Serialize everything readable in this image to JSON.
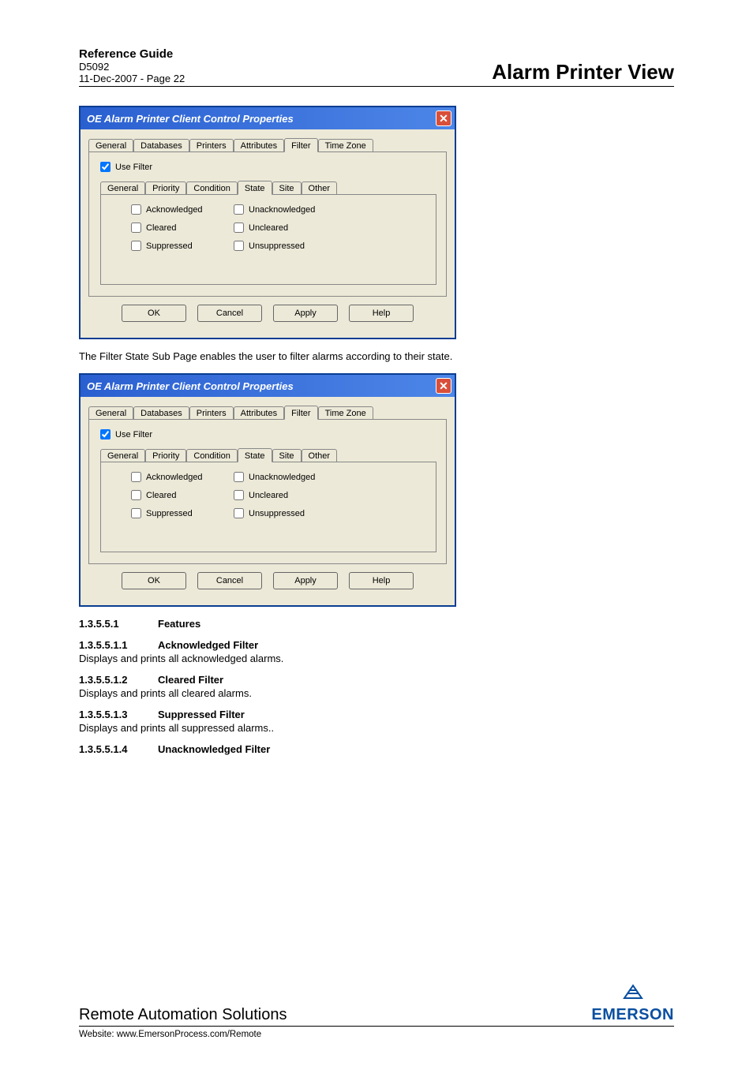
{
  "header": {
    "ref_guide": "Reference Guide",
    "doc_id": "D5092",
    "date_page": "11-Dec-2007 - Page 22",
    "view_title": "Alarm Printer View"
  },
  "dialog": {
    "title": "OE Alarm Printer Client Control Properties",
    "close_icon": "✕",
    "main_tabs": [
      "General",
      "Databases",
      "Printers",
      "Attributes",
      "Filter",
      "Time Zone"
    ],
    "main_tab_selected": 4,
    "use_filter_label": "Use Filter",
    "use_filter_checked": true,
    "sub_tabs": [
      "General",
      "Priority",
      "Condition",
      "State",
      "Site",
      "Other"
    ],
    "sub_tab_selected": 3,
    "state_checks": [
      {
        "label": "Acknowledged",
        "checked": false
      },
      {
        "label": "Unacknowledged",
        "checked": false
      },
      {
        "label": "Cleared",
        "checked": false
      },
      {
        "label": "Uncleared",
        "checked": false
      },
      {
        "label": "Suppressed",
        "checked": false
      },
      {
        "label": "Unsuppressed",
        "checked": false
      }
    ],
    "buttons": {
      "ok": "OK",
      "cancel": "Cancel",
      "apply": "Apply",
      "help": "Help"
    }
  },
  "desc_text": "The Filter State Sub Page enables the user to filter alarms according to their state.",
  "sections": [
    {
      "num": "1.3.5.5.1",
      "title": "Features",
      "body": ""
    },
    {
      "num": "1.3.5.5.1.1",
      "title": "Acknowledged Filter",
      "body": "Displays and prints all acknowledged alarms."
    },
    {
      "num": "1.3.5.5.1.2",
      "title": "Cleared Filter",
      "body": "Displays and prints all cleared alarms."
    },
    {
      "num": "1.3.5.5.1.3",
      "title": "Suppressed Filter",
      "body": "Displays and prints all suppressed alarms.."
    },
    {
      "num": "1.3.5.5.1.4",
      "title": "Unacknowledged Filter",
      "body": ""
    }
  ],
  "footer": {
    "company": "Remote Automation Solutions",
    "logo_text": "EMERSON",
    "website_label": "Website:  www.EmersonProcess.com/Remote"
  }
}
